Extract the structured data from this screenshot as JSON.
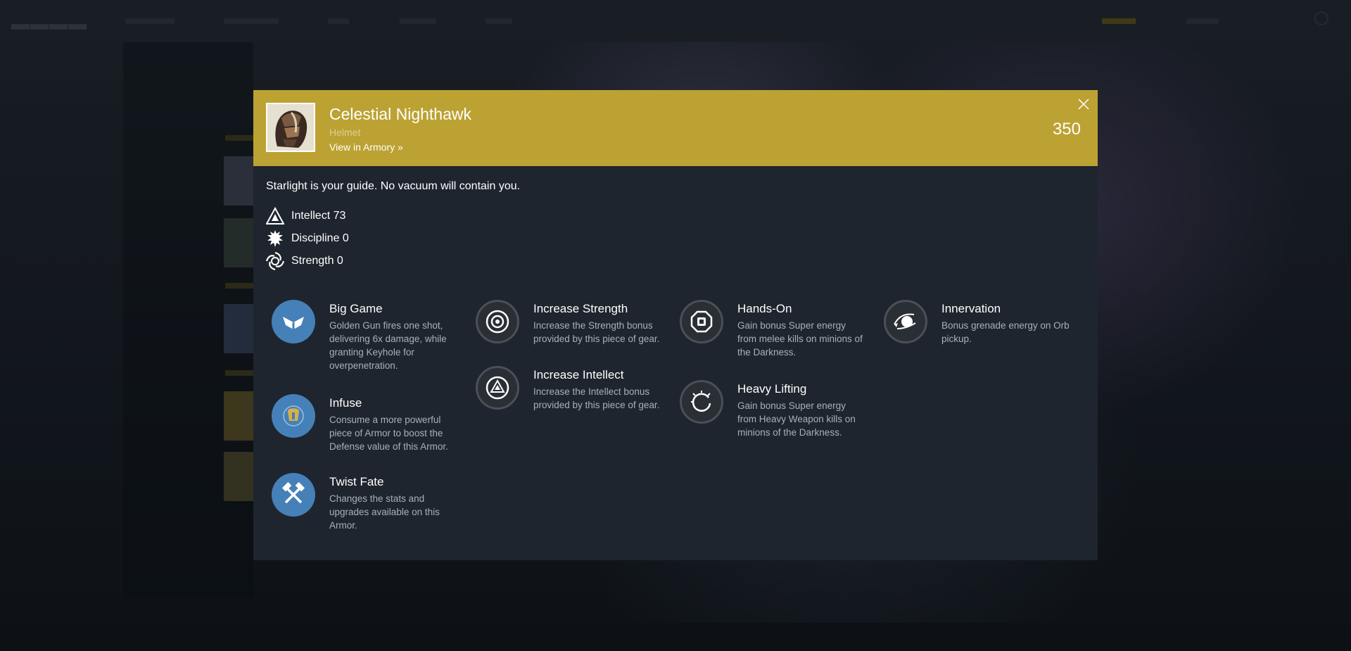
{
  "item": {
    "name": "Celestial Nighthawk",
    "type": "Helmet",
    "armory_link": "View in Armory »",
    "power": "350",
    "description": "Starlight is your guide. No vacuum will contain you."
  },
  "stats": [
    {
      "label": "Intellect 73",
      "icon": "intellect-icon"
    },
    {
      "label": "Discipline 0",
      "icon": "discipline-icon"
    },
    {
      "label": "Strength 0",
      "icon": "strength-icon"
    }
  ],
  "perks": {
    "big_game": {
      "title": "Big Game",
      "desc": "Golden Gun fires one shot, delivering 6x damage, while granting Keyhole for overpenetration."
    },
    "infuse": {
      "title": "Infuse",
      "desc": "Consume a more powerful piece of Armor to boost the Defense value of this Armor."
    },
    "twist_fate": {
      "title": "Twist Fate",
      "desc": "Changes the stats and upgrades available on this Armor."
    },
    "increase_strength": {
      "title": "Increase Strength",
      "desc": "Increase the Strength bonus provided by this piece of gear."
    },
    "increase_intellect": {
      "title": "Increase Intellect",
      "desc": "Increase the Intellect bonus provided by this piece of gear."
    },
    "hands_on": {
      "title": "Hands-On",
      "desc": "Gain bonus Super energy from melee kills on minions of the Darkness."
    },
    "heavy_lifting": {
      "title": "Heavy Lifting",
      "desc": "Gain bonus Super energy from Heavy Weapon kills on minions of the Darkness."
    },
    "innervation": {
      "title": "Innervation",
      "desc": "Bonus grenade energy on Orb pickup."
    }
  },
  "colors": {
    "header_accent": "#bca233",
    "modal_bg": "#1f252e",
    "perk_blue": "#4680b8"
  }
}
